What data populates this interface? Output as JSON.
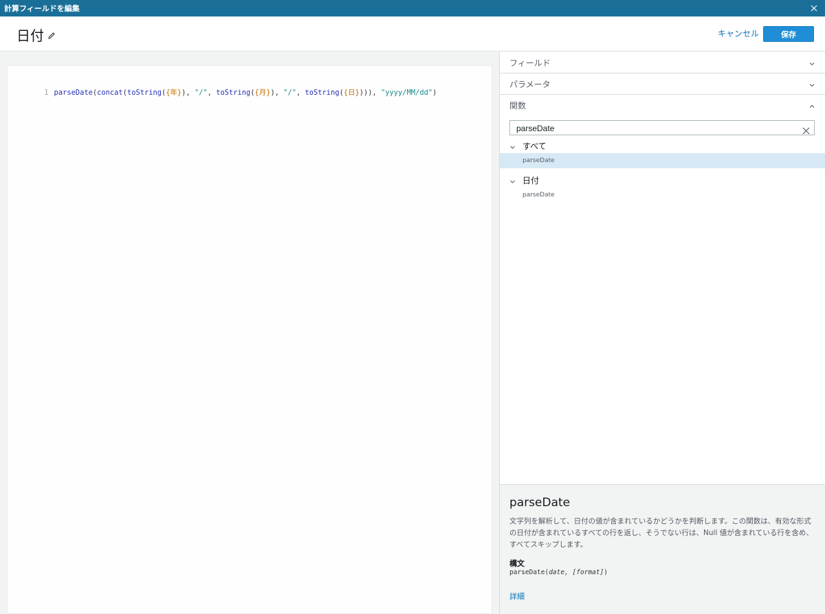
{
  "window": {
    "title": "計算フィールドを編集",
    "close_icon": "close-icon"
  },
  "header": {
    "field_name": "日付",
    "edit_icon": "pencil-icon",
    "cancel_label": "キャンセル",
    "save_label": "保存"
  },
  "editor": {
    "line_number": "1",
    "tokens": [
      {
        "t": "parseDate",
        "k": "fn"
      },
      {
        "t": "(",
        "k": "p"
      },
      {
        "t": "concat",
        "k": "fn"
      },
      {
        "t": "(",
        "k": "p"
      },
      {
        "t": "toString",
        "k": "fn"
      },
      {
        "t": "(",
        "k": "p"
      },
      {
        "t": "{年}",
        "k": "field"
      },
      {
        "t": "), ",
        "k": "p"
      },
      {
        "t": "\"/\"",
        "k": "str"
      },
      {
        "t": ", ",
        "k": "p"
      },
      {
        "t": "toString",
        "k": "fn"
      },
      {
        "t": "(",
        "k": "p"
      },
      {
        "t": "{月}",
        "k": "field"
      },
      {
        "t": "), ",
        "k": "p"
      },
      {
        "t": "\"/\"",
        "k": "str"
      },
      {
        "t": ", ",
        "k": "p"
      },
      {
        "t": "toString",
        "k": "fn"
      },
      {
        "t": "(",
        "k": "p"
      },
      {
        "t": "{日}",
        "k": "field"
      },
      {
        "t": "))), ",
        "k": "p"
      },
      {
        "t": "\"yyyy/MM/dd\"",
        "k": "str"
      },
      {
        "t": ")",
        "k": "p"
      }
    ]
  },
  "panel": {
    "fields_label": "フィールド",
    "parameters_label": "パラメータ",
    "functions_label": "関数",
    "search_value": "parseDate",
    "groups": [
      {
        "label": "すべて",
        "items": [
          "parseDate"
        ]
      },
      {
        "label": "日付",
        "items": [
          "parseDate"
        ]
      }
    ],
    "description": {
      "title": "parseDate",
      "text": "文字列を解析して、日付の値が含まれているかどうかを判断します。この関数は、有効な形式の日付が含まれているすべての行を返し、そうでない行は、Null 値が含まれている行を含め、すべてスキップします。",
      "syntax_label": "構文",
      "syntax_fn": "parseDate(",
      "syntax_args": "date, [format]",
      "syntax_close": ")",
      "details_label": "詳細"
    }
  }
}
